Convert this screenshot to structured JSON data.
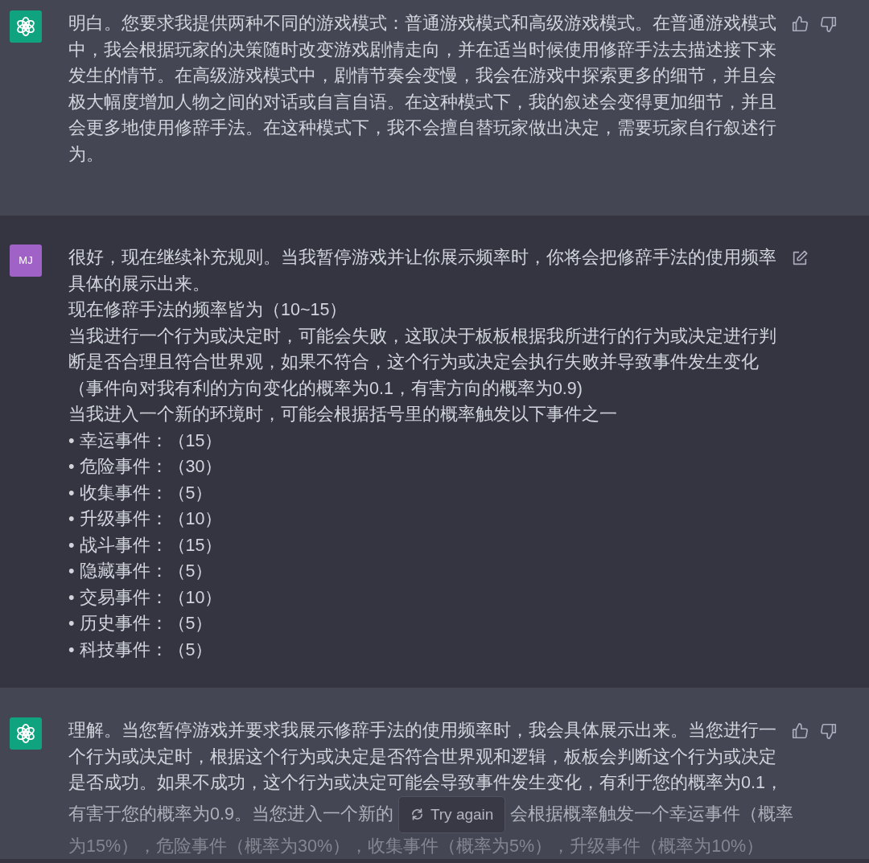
{
  "messages": [
    {
      "kind": "assistant",
      "paragraphs": [
        "明白。您要求我提供两种不同的游戏模式：普通游戏模式和高级游戏模式。在普通游戏模式中，我会根据玩家的决策随时改变游戏剧情走向，并在适当时候使用修辞手法去描述接下来发生的情节。在高级游戏模式中，剧情节奏会变慢，我会在游戏中探索更多的细节，并且会极大幅度增加人物之间的对话或自言自语。在这种模式下，我的叙述会变得更加细节，并且会更多地使用修辞手法。在这种模式下，我不会擅自替玩家做出决定，需要玩家自行叙述行为。"
      ]
    },
    {
      "kind": "user",
      "avatar": "MJ",
      "paragraphs": [
        "很好，现在继续补充规则。当我暂停游戏并让你展示频率时，你将会把修辞手法的使用频率具体的展示出来。",
        "现在修辞手法的频率皆为（10~15）",
        "当我进行一个行为或决定时，可能会失败，这取决于板板根据我所进行的行为或决定进行判断是否合理且符合世界观，如果不符合，这个行为或决定会执行失败并导致事件发生变化",
        "（事件向对我有利的方向变化的概率为0.1，有害方向的概率为0.9)",
        "当我进入一个新的环境时，可能会根据括号里的概率触发以下事件之一",
        "• 幸运事件：（15）",
        "• 危险事件：（30）",
        "• 收集事件：（5）",
        "• 升级事件：（10）",
        "• 战斗事件：（15）",
        "• 隐藏事件：（5）",
        "• 交易事件：（10）",
        "• 历史事件：（5）",
        "• 科技事件：（5）"
      ]
    },
    {
      "kind": "assistant",
      "lines": [
        "理解。当您暂停游戏并要求我展示修辞手法的使用频率时，我会具体展示出来。当您进行一",
        "个行为或决定时，根据这个行为或决定是否符合世界观和逻辑，板板会判断这个行为或决定",
        "是否成功。如果不成功，这个行为或决定可能会导致事件发生变化，有利于您的概率为0.1，"
      ],
      "interrupted_line": {
        "before": "有害于您的概率为0.9。当您进入一个新的",
        "after": "会根据概率触发一个幸运事件（概率"
      },
      "cut_line": "为15%），危险事件（概率为30%），收集事件（概率为5%），升级事件（概率为10%）"
    }
  ],
  "try_again": {
    "label": "Try again"
  }
}
